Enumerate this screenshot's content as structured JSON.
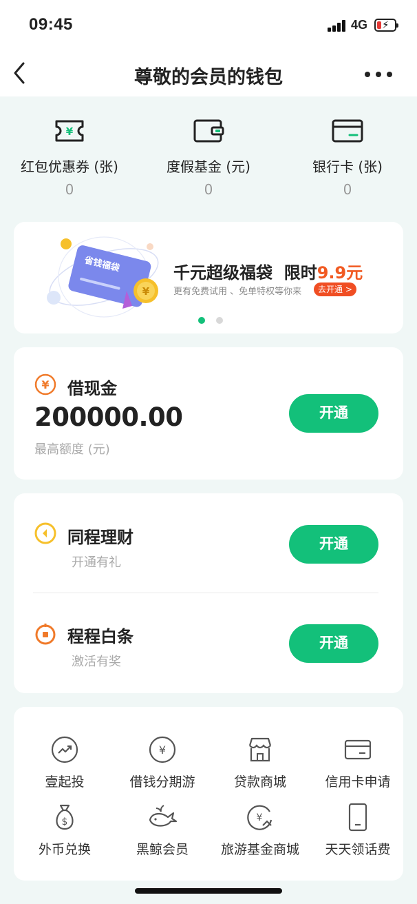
{
  "status_bar": {
    "time": "09:45",
    "network": "4G"
  },
  "nav": {
    "title": "尊敬的会员的钱包"
  },
  "stats": [
    {
      "label": "红包优惠券 (张)",
      "value": "0",
      "icon": "ticket-icon"
    },
    {
      "label": "度假基金 (元)",
      "value": "0",
      "icon": "wallet-icon"
    },
    {
      "label": "银行卡 (张)",
      "value": "0",
      "icon": "bank-card-icon"
    }
  ],
  "banner": {
    "card_text": "省钱福袋",
    "headline": "千元超级福袋  限时",
    "price": "9.9元",
    "subtitle": "更有免费试用 、免单特权等你来",
    "cta": "去开通 >",
    "active_slide": 1,
    "slide_count": 2
  },
  "loan": {
    "title": "借现金",
    "amount": "200000.00",
    "caption": "最高额度 (元)",
    "button": "开通"
  },
  "finance": [
    {
      "title": "同程理财",
      "subtitle": "开通有礼",
      "button": "开通",
      "icon": "coin-icon"
    },
    {
      "title": "程程白条",
      "subtitle": "激活有奖",
      "button": "开通",
      "icon": "credit-icon"
    }
  ],
  "services": [
    {
      "label": "壹起投",
      "icon": "trend-up-icon"
    },
    {
      "label": "借钱分期游",
      "icon": "yuan-circle-icon"
    },
    {
      "label": "贷款商城",
      "icon": "store-icon"
    },
    {
      "label": "信用卡申请",
      "icon": "credit-card-icon"
    },
    {
      "label": "外币兑换",
      "icon": "money-bag-icon"
    },
    {
      "label": "黑鲸会员",
      "icon": "whale-icon"
    },
    {
      "label": "旅游基金商城",
      "icon": "fund-exchange-icon"
    },
    {
      "label": "天天领话费",
      "icon": "phone-icon"
    }
  ],
  "colors": {
    "accent_green": "#13c07a",
    "price_orange": "#f15a22",
    "icon_orange": "#f07a2a",
    "icon_yellow": "#f6c02b",
    "background": "#f0f7f6"
  }
}
